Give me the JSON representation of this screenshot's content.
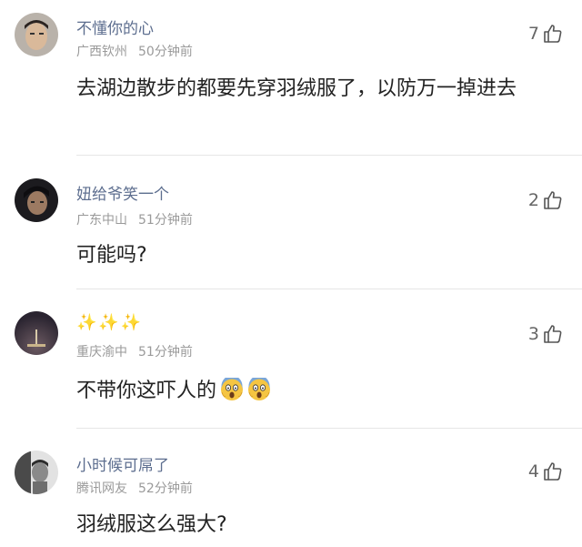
{
  "comments": [
    {
      "username": "不懂你的心",
      "location": "广西钦州",
      "time": "50分钟前",
      "likes": "7",
      "text": "去湖边散步的都要先穿羽绒服了，以防万一掉进去"
    },
    {
      "username": "妞给爷笑一个",
      "location": "广东中山",
      "time": "51分钟前",
      "likes": "2",
      "text": "可能吗?"
    },
    {
      "username": "✨✨✨",
      "location": "重庆渝中",
      "time": "51分钟前",
      "likes": "3",
      "text": "不带你这吓人的",
      "emoji": [
        "scream-emoji",
        "scream-emoji"
      ]
    },
    {
      "username": "小时候可屌了",
      "location": "腾讯网友",
      "time": "52分钟前",
      "likes": "4",
      "text": "羽绒服这么强大?"
    }
  ],
  "icons": {
    "like": "thumbs-up-outline-icon"
  },
  "colors": {
    "username": "#5d6e8f",
    "meta": "#9a9a9a",
    "text": "#222222",
    "divider": "#e6e6e6"
  }
}
